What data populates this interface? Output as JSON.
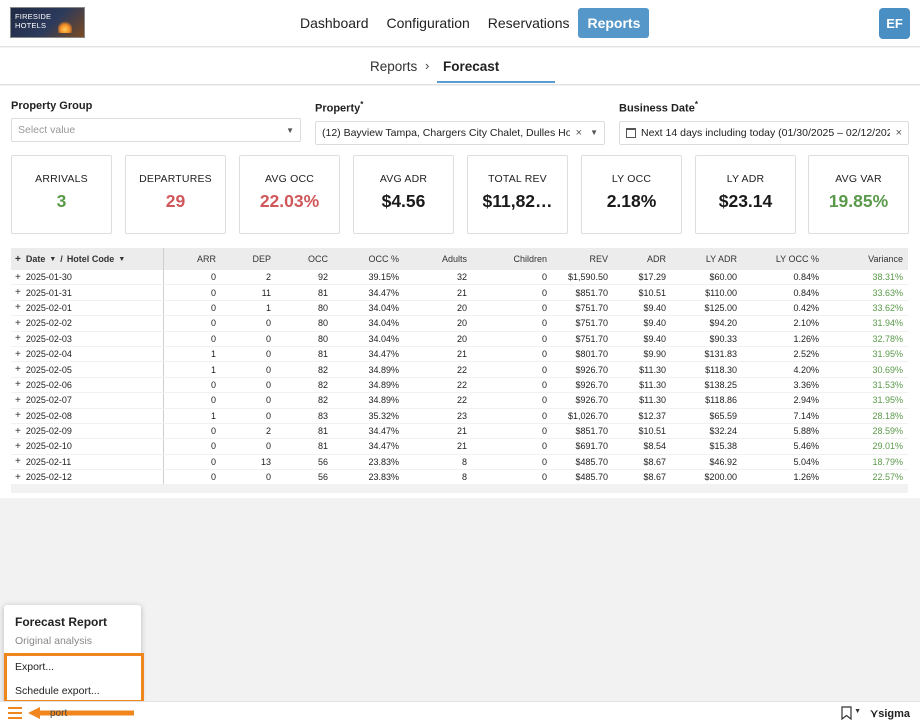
{
  "brand": {
    "logo_text_line1": "FIRESIDE",
    "logo_text_line2": "HOTELS"
  },
  "nav": {
    "items": [
      "Dashboard",
      "Configuration",
      "Reservations",
      "Reports"
    ],
    "active": "Reports"
  },
  "user": {
    "initials": "EF"
  },
  "breadcrumb": {
    "parent": "Reports",
    "separator": "›",
    "current": "Forecast"
  },
  "filters": {
    "property_group": {
      "label": "Property Group",
      "placeholder": "Select value"
    },
    "property": {
      "label": "Property",
      "required_mark": "*",
      "value": "(12) Bayview Tampa, Chargers City Chalet, Dulles Hote…"
    },
    "business_date": {
      "label": "Business Date",
      "required_mark": "*",
      "value": "Next 14 days including today (01/30/2025 – 02/12/2025)"
    }
  },
  "kpis": [
    {
      "label": "ARRIVALS",
      "value": "3",
      "tone": "green"
    },
    {
      "label": "DEPARTURES",
      "value": "29",
      "tone": "red"
    },
    {
      "label": "AVG OCC",
      "value": "22.03%",
      "tone": "red"
    },
    {
      "label": "AVG ADR",
      "value": "$4.56",
      "tone": "dark"
    },
    {
      "label": "TOTAL REV",
      "value": "$11,82…",
      "tone": "dark"
    },
    {
      "label": "LY OCC",
      "value": "2.18%",
      "tone": "dark"
    },
    {
      "label": "LY ADR",
      "value": "$23.14",
      "tone": "dark"
    },
    {
      "label": "AVG VAR",
      "value": "19.85%",
      "tone": "green"
    }
  ],
  "table": {
    "key_header": {
      "date": "Date",
      "sep": "/",
      "hotel": "Hotel Code",
      "expand": "+"
    },
    "columns": [
      "ARR",
      "DEP",
      "OCC",
      "OCC %",
      "Adults",
      "Children",
      "REV",
      "ADR",
      "LY ADR",
      "LY OCC %",
      "Variance"
    ],
    "rows": [
      [
        "2025-01-30",
        "0",
        "2",
        "92",
        "39.15%",
        "32",
        "0",
        "$1,590.50",
        "$17.29",
        "$60.00",
        "0.84%",
        "38.31%"
      ],
      [
        "2025-01-31",
        "0",
        "11",
        "81",
        "34.47%",
        "21",
        "0",
        "$851.70",
        "$10.51",
        "$110.00",
        "0.84%",
        "33.63%"
      ],
      [
        "2025-02-01",
        "0",
        "1",
        "80",
        "34.04%",
        "20",
        "0",
        "$751.70",
        "$9.40",
        "$125.00",
        "0.42%",
        "33.62%"
      ],
      [
        "2025-02-02",
        "0",
        "0",
        "80",
        "34.04%",
        "20",
        "0",
        "$751.70",
        "$9.40",
        "$94.20",
        "2.10%",
        "31.94%"
      ],
      [
        "2025-02-03",
        "0",
        "0",
        "80",
        "34.04%",
        "20",
        "0",
        "$751.70",
        "$9.40",
        "$90.33",
        "1.26%",
        "32.78%"
      ],
      [
        "2025-02-04",
        "1",
        "0",
        "81",
        "34.47%",
        "21",
        "0",
        "$801.70",
        "$9.90",
        "$131.83",
        "2.52%",
        "31.95%"
      ],
      [
        "2025-02-05",
        "1",
        "0",
        "82",
        "34.89%",
        "22",
        "0",
        "$926.70",
        "$11.30",
        "$118.30",
        "4.20%",
        "30.69%"
      ],
      [
        "2025-02-06",
        "0",
        "0",
        "82",
        "34.89%",
        "22",
        "0",
        "$926.70",
        "$11.30",
        "$138.25",
        "3.36%",
        "31.53%"
      ],
      [
        "2025-02-07",
        "0",
        "0",
        "82",
        "34.89%",
        "22",
        "0",
        "$926.70",
        "$11.30",
        "$118.86",
        "2.94%",
        "31.95%"
      ],
      [
        "2025-02-08",
        "1",
        "0",
        "83",
        "35.32%",
        "23",
        "0",
        "$1,026.70",
        "$12.37",
        "$65.59",
        "7.14%",
        "28.18%"
      ],
      [
        "2025-02-09",
        "0",
        "2",
        "81",
        "34.47%",
        "21",
        "0",
        "$851.70",
        "$10.51",
        "$32.24",
        "5.88%",
        "28.59%"
      ],
      [
        "2025-02-10",
        "0",
        "0",
        "81",
        "34.47%",
        "21",
        "0",
        "$691.70",
        "$8.54",
        "$15.38",
        "5.46%",
        "29.01%"
      ],
      [
        "2025-02-11",
        "0",
        "13",
        "56",
        "23.83%",
        "8",
        "0",
        "$485.70",
        "$8.67",
        "$46.92",
        "5.04%",
        "18.79%"
      ],
      [
        "2025-02-12",
        "0",
        "0",
        "56",
        "23.83%",
        "8",
        "0",
        "$485.70",
        "$8.67",
        "$200.00",
        "1.26%",
        "22.57%"
      ]
    ]
  },
  "popup_menu": {
    "title": "Forecast Report",
    "subtitle": "Original analysis",
    "items": [
      "Export...",
      "Schedule export..."
    ]
  },
  "bottom": {
    "tab_label": "port",
    "sigma_label": "sigma"
  },
  "colors": {
    "accent": "#5497c8",
    "highlight": "#f0871e",
    "positive": "#5a9a4a",
    "negative": "#d0585b"
  }
}
